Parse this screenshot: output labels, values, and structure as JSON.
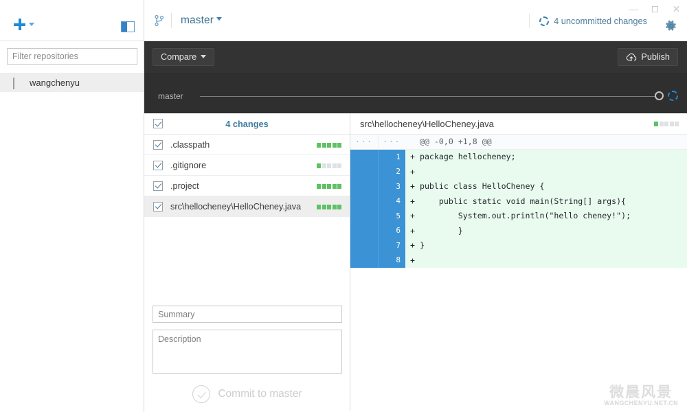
{
  "window": {
    "minimize_label": "—",
    "maximize_label": "□",
    "close_label": "✕"
  },
  "sidebar": {
    "add_repo_label": "+",
    "add_repo_caret": "▾",
    "toggle_name": "sidebar-toggle-icon",
    "filter": {
      "placeholder": "Filter repositories",
      "value": ""
    },
    "repositories": [
      {
        "name": "wangchenyu",
        "icon": "monitor-icon",
        "selected": true
      }
    ]
  },
  "titlebar": {
    "branch_icon": "branch-icon",
    "branch_name": "master",
    "branch_caret": "▾",
    "uncommitted_label": "4 uncommitted changes",
    "uncommitted_icon": "sync-dashed-circle-icon",
    "settings_icon": "gear-icon"
  },
  "toolbar": {
    "compare_label": "Compare",
    "compare_caret": "▾",
    "publish_label": "Publish",
    "publish_icon": "cloud-upload-icon"
  },
  "graph": {
    "branch_label": "master",
    "nodes": [
      {
        "name": "commit-node",
        "style": "solid-gray"
      },
      {
        "name": "uncommitted-node",
        "style": "dashed-blue"
      }
    ]
  },
  "changes": {
    "header_label": "4 changes",
    "all_checked": true,
    "files": [
      {
        "name": ".classpath",
        "checked": true,
        "bars": [
          1,
          1,
          1,
          1,
          1
        ],
        "selected": false
      },
      {
        "name": ".gitignore",
        "checked": true,
        "bars": [
          1,
          0,
          0,
          0,
          0
        ],
        "selected": false
      },
      {
        "name": ".project",
        "checked": true,
        "bars": [
          1,
          1,
          1,
          1,
          1
        ],
        "selected": false
      },
      {
        "name": "src\\hellocheney\\HelloCheney.java",
        "checked": true,
        "bars": [
          1,
          1,
          1,
          1,
          1
        ],
        "selected": true
      }
    ]
  },
  "commit": {
    "summary_placeholder": "Summary",
    "summary_value": "",
    "description_placeholder": "Description",
    "description_value": "",
    "button_label": "Commit to master",
    "button_enabled": false
  },
  "diff": {
    "file_path": "src\\hellocheney\\HelloCheney.java",
    "header_bars": [
      1,
      0,
      0,
      0,
      0
    ],
    "lines": [
      {
        "type": "hunk",
        "old": "···",
        "new": "···",
        "code": "  @@ -0,0 +1,8 @@"
      },
      {
        "type": "add",
        "old": "",
        "new": "1",
        "code": "+ package hellocheney;"
      },
      {
        "type": "add",
        "old": "",
        "new": "2",
        "code": "+ "
      },
      {
        "type": "add",
        "old": "",
        "new": "3",
        "code": "+ public class HelloCheney {"
      },
      {
        "type": "add",
        "old": "",
        "new": "4",
        "code": "+     public static void main(String[] args){"
      },
      {
        "type": "add",
        "old": "",
        "new": "5",
        "code": "+         System.out.println(\"hello cheney!\");"
      },
      {
        "type": "add",
        "old": "",
        "new": "6",
        "code": "+         }"
      },
      {
        "type": "add",
        "old": "",
        "new": "7",
        "code": "+ }"
      },
      {
        "type": "add",
        "old": "",
        "new": "8",
        "code": "+ "
      }
    ]
  },
  "watermark": {
    "cn_text": "微晨风景",
    "en_text": "WANGCHENYU.NET.CN"
  },
  "colors": {
    "accent_blue": "#3b92d4",
    "link_blue": "#3d7191",
    "dark_toolbar": "#333333",
    "graph_strip": "#2f2f2f",
    "diff_add_bg": "#e9fbee",
    "diff_bar_green": "#5ec163"
  }
}
